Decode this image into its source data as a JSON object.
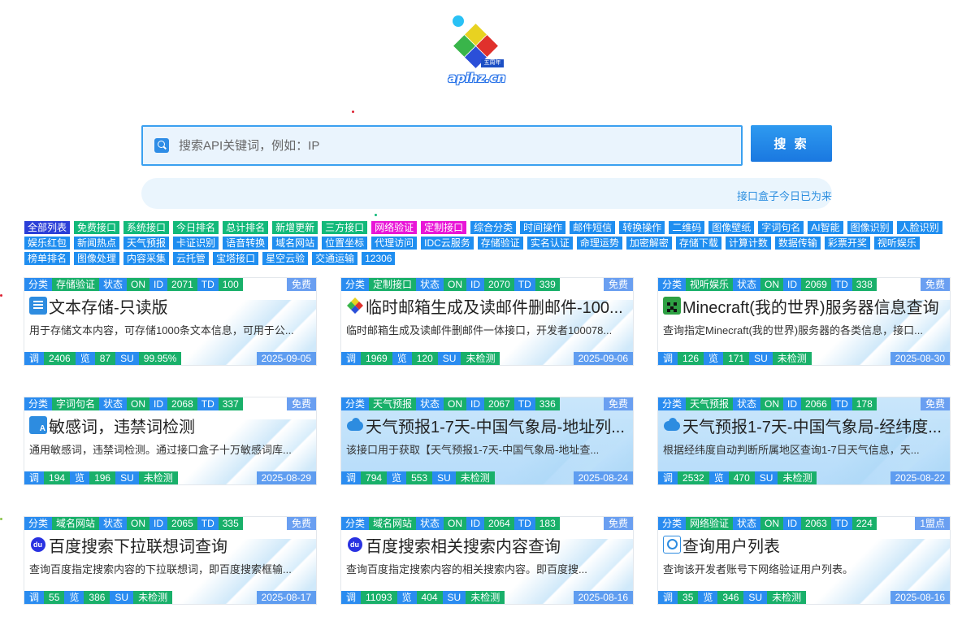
{
  "logo": {
    "brand": "apihz.cn",
    "tag": "五周年",
    "colors": [
      "#29c1f5",
      "#e8d221",
      "#39b54a",
      "#e0312c",
      "#2b4fd8"
    ]
  },
  "search": {
    "placeholder": "搜索API关键词，例如：IP",
    "button_label": "搜 索"
  },
  "marquee": {
    "text": "接口盒子今日已为来"
  },
  "tags": [
    {
      "label": "全部列表",
      "color": "#2b3fd8"
    },
    {
      "label": "免费接口",
      "color": "#12b97a"
    },
    {
      "label": "系统接口",
      "color": "#12b97a"
    },
    {
      "label": "今日排名",
      "color": "#12b97a"
    },
    {
      "label": "总计排名",
      "color": "#12b97a"
    },
    {
      "label": "新增更新",
      "color": "#12b97a"
    },
    {
      "label": "三方接口",
      "color": "#12b97a"
    },
    {
      "label": "网络验证",
      "color": "#e815d7"
    },
    {
      "label": "定制接口",
      "color": "#e815d7"
    },
    {
      "label": "综合分类",
      "color": "#1f8ef0"
    },
    {
      "label": "时间操作",
      "color": "#1f8ef0"
    },
    {
      "label": "邮件短信",
      "color": "#1f8ef0"
    },
    {
      "label": "转换操作",
      "color": "#1f8ef0"
    },
    {
      "label": "二维码",
      "color": "#1f8ef0"
    },
    {
      "label": "图像壁纸",
      "color": "#1f8ef0"
    },
    {
      "label": "字词句名",
      "color": "#1f8ef0"
    },
    {
      "label": "AI智能",
      "color": "#1f8ef0"
    },
    {
      "label": "图像识别",
      "color": "#1f8ef0"
    },
    {
      "label": "人脸识别",
      "color": "#1f8ef0"
    },
    {
      "label": "娱乐红包",
      "color": "#1f8ef0"
    },
    {
      "label": "新闻热点",
      "color": "#1f8ef0"
    },
    {
      "label": "天气预报",
      "color": "#1f8ef0"
    },
    {
      "label": "卡证识别",
      "color": "#1f8ef0"
    },
    {
      "label": "语音转换",
      "color": "#1f8ef0"
    },
    {
      "label": "域名网站",
      "color": "#1f8ef0"
    },
    {
      "label": "位置坐标",
      "color": "#1f8ef0"
    },
    {
      "label": "代理访问",
      "color": "#1f8ef0"
    },
    {
      "label": "IDC云服务",
      "color": "#1f8ef0"
    },
    {
      "label": "存储验证",
      "color": "#1f8ef0"
    },
    {
      "label": "实名认证",
      "color": "#1f8ef0"
    },
    {
      "label": "命理运势",
      "color": "#1f8ef0"
    },
    {
      "label": "加密解密",
      "color": "#1f8ef0"
    },
    {
      "label": "存储下载",
      "color": "#1f8ef0"
    },
    {
      "label": "计算计数",
      "color": "#1f8ef0"
    },
    {
      "label": "数据传输",
      "color": "#1f8ef0"
    },
    {
      "label": "彩票开奖",
      "color": "#1f8ef0"
    },
    {
      "label": "视听娱乐",
      "color": "#1f8ef0"
    },
    {
      "label": "榜单排名",
      "color": "#1f8ef0"
    },
    {
      "label": "图像处理",
      "color": "#1f8ef0"
    },
    {
      "label": "内容采集",
      "color": "#1f8ef0"
    },
    {
      "label": "云托管",
      "color": "#1f8ef0"
    },
    {
      "label": "宝塔接口",
      "color": "#1f8ef0"
    },
    {
      "label": "星空云验",
      "color": "#1f8ef0"
    },
    {
      "label": "交通运输",
      "color": "#1f8ef0"
    },
    {
      "label": "12306",
      "color": "#1f8ef0"
    }
  ],
  "card_labels": {
    "category": "分类",
    "status": "状态",
    "id": "ID",
    "td": "TD",
    "calls": "调",
    "views": "览",
    "su": "SU"
  },
  "cards": [
    {
      "category": "存储验证",
      "status": "ON",
      "id": "2071",
      "td": "100",
      "price": "免费",
      "icon": "doc-icon",
      "title": "文本存储-只读版",
      "desc": "用于存储文本内容，可存储1000条文本信息，可用于公...",
      "calls": "2406",
      "views": "87",
      "su": "99.95%",
      "date": "2025-09-05",
      "highlight": false
    },
    {
      "category": "定制接口",
      "status": "ON",
      "id": "2070",
      "td": "339",
      "price": "免费",
      "icon": "mail-icon",
      "title": "临时邮箱生成及读邮件删邮件-100...",
      "desc": "临时邮箱生成及读邮件删邮件一体接口，开发者100078...",
      "calls": "1969",
      "views": "120",
      "su": "未检测",
      "date": "2025-09-06",
      "highlight": false
    },
    {
      "category": "视听娱乐",
      "status": "ON",
      "id": "2069",
      "td": "338",
      "price": "免费",
      "icon": "minecraft-icon",
      "title": "Minecraft(我的世界)服务器信息查询",
      "desc": "查询指定Minecraft(我的世界)服务器的各类信息，接口...",
      "calls": "126",
      "views": "171",
      "su": "未检测",
      "date": "2025-08-30",
      "highlight": false
    },
    {
      "category": "字词句名",
      "status": "ON",
      "id": "2068",
      "td": "337",
      "price": "免费",
      "icon": "translate-icon",
      "title": "敏感词，违禁词检测",
      "desc": "通用敏感词，违禁词检测。通过接口盒子十万敏感词库...",
      "calls": "194",
      "views": "196",
      "su": "未检测",
      "date": "2025-08-29",
      "highlight": false
    },
    {
      "category": "天气预报",
      "status": "ON",
      "id": "2067",
      "td": "336",
      "price": "免费",
      "icon": "cloud-icon",
      "title": "天气预报1-7天-中国气象局-地址列...",
      "desc": "该接口用于获取【天气预报1-7天-中国气象局-地址查...",
      "calls": "794",
      "views": "553",
      "su": "未检测",
      "date": "2025-08-24",
      "highlight": true
    },
    {
      "category": "天气预报",
      "status": "ON",
      "id": "2066",
      "td": "178",
      "price": "免费",
      "icon": "cloud-icon",
      "title": "天气预报1-7天-中国气象局-经纬度...",
      "desc": "根据经纬度自动判断所属地区查询1-7日天气信息，天...",
      "calls": "2532",
      "views": "470",
      "su": "未检测",
      "date": "2025-08-22",
      "highlight": true
    },
    {
      "category": "域名网站",
      "status": "ON",
      "id": "2065",
      "td": "335",
      "price": "免费",
      "icon": "baidu-icon",
      "title": "百度搜索下拉联想词查询",
      "desc": "查询百度指定搜索内容的下拉联想词，即百度搜索框输...",
      "calls": "55",
      "views": "386",
      "su": "未检测",
      "date": "2025-08-17",
      "highlight": false
    },
    {
      "category": "域名网站",
      "status": "ON",
      "id": "2064",
      "td": "183",
      "price": "免费",
      "icon": "baidu-icon",
      "title": "百度搜索相关搜索内容查询",
      "desc": "查询百度指定搜索内容的相关搜索内容。即百度搜...",
      "calls": "11093",
      "views": "404",
      "su": "未检测",
      "date": "2025-08-16",
      "highlight": false
    },
    {
      "category": "网络验证",
      "status": "ON",
      "id": "2063",
      "td": "224",
      "price": "1盟点",
      "icon": "find-icon",
      "title": "查询用户列表",
      "desc": "查询该开发者账号下网络验证用户列表。",
      "calls": "35",
      "views": "346",
      "su": "未检测",
      "date": "2025-08-16",
      "highlight": false
    }
  ]
}
